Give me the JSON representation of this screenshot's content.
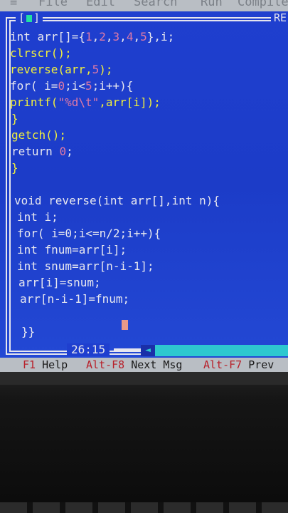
{
  "menu": {
    "items": [
      "≡",
      "File",
      "Edit",
      "Search",
      "Run",
      "Compile"
    ]
  },
  "window": {
    "close_glyph": "[",
    "close_glyph_end": "]",
    "title_right": "RE",
    "cursor_position": "26:15",
    "scroll_arrow": "◄"
  },
  "code_lines": [
    [
      {
        "t": "int arr[]={",
        "c": "w"
      },
      {
        "t": "1",
        "c": "s"
      },
      {
        "t": ",",
        "c": "w"
      },
      {
        "t": "2",
        "c": "s"
      },
      {
        "t": ",",
        "c": "w"
      },
      {
        "t": "3",
        "c": "s"
      },
      {
        "t": ",",
        "c": "w"
      },
      {
        "t": "4",
        "c": "s"
      },
      {
        "t": ",",
        "c": "w"
      },
      {
        "t": "5",
        "c": "s"
      },
      {
        "t": "},i;",
        "c": "w"
      }
    ],
    [
      {
        "t": "clrscr();",
        "c": "y"
      }
    ],
    [
      {
        "t": "reverse(arr,",
        "c": "y"
      },
      {
        "t": "5",
        "c": "s"
      },
      {
        "t": ");",
        "c": "y"
      }
    ],
    [
      {
        "t": "for( i=",
        "c": "w"
      },
      {
        "t": "0",
        "c": "s"
      },
      {
        "t": ";i<",
        "c": "w"
      },
      {
        "t": "5",
        "c": "s"
      },
      {
        "t": ";i++){",
        "c": "w"
      }
    ],
    [
      {
        "t": "printf(",
        "c": "y"
      },
      {
        "t": "\"%d\\t\"",
        "c": "s"
      },
      {
        "t": ",arr[i]);",
        "c": "y"
      }
    ],
    [
      {
        "t": "}",
        "c": "y"
      }
    ],
    [
      {
        "t": "getch();",
        "c": "y"
      }
    ],
    [
      {
        "t": "return ",
        "c": "w"
      },
      {
        "t": "0",
        "c": "s"
      },
      {
        "t": ";",
        "c": "w"
      }
    ],
    [
      {
        "t": "}",
        "c": "y"
      }
    ],
    [
      {
        "t": "",
        "c": "w"
      }
    ],
    [
      {
        "t": "void reverse(int arr[],int n){",
        "c": "w"
      }
    ],
    [
      {
        "t": "int i;",
        "c": "w"
      }
    ],
    [
      {
        "t": "for( i=0;i<=n/2;i++){",
        "c": "w"
      }
    ],
    [
      {
        "t": "int fnum=arr[i];",
        "c": "w"
      }
    ],
    [
      {
        "t": "int snum=arr[n-i-1];",
        "c": "w"
      }
    ],
    [
      {
        "t": "arr[i]=snum;",
        "c": "w"
      }
    ],
    [
      {
        "t": "arr[n-i-1]=fnum;",
        "c": "w"
      }
    ],
    [
      {
        "t": "",
        "c": "w"
      }
    ],
    [
      {
        "t": "}}",
        "c": "w"
      }
    ]
  ],
  "line_indents": [
    0,
    0,
    0,
    0,
    0,
    2,
    2,
    2,
    2,
    0,
    6,
    10,
    10,
    10,
    10,
    12,
    14,
    0,
    16
  ],
  "function_keys": [
    {
      "key": "F1",
      "label": "Help"
    },
    {
      "key": "Alt-F8",
      "label": "Next Msg"
    },
    {
      "key": "Alt-F7",
      "label": "Prev"
    }
  ],
  "colors": {
    "editor_background": "#1f3fcf",
    "keyword_yellow": "#f1ef3c",
    "text_white": "#e8e8ef",
    "number_pink": "#e07aa6",
    "scrollbar_cyan": "#2ec8cf",
    "function_key_red": "#b8202a",
    "statusbar_gray": "#b9bec4"
  }
}
